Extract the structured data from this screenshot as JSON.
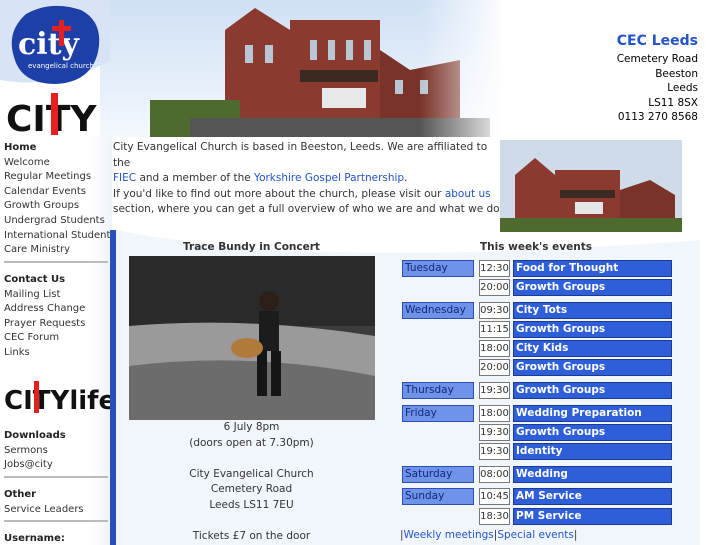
{
  "header": {
    "church_name": "CEC Leeds",
    "address": [
      "Cemetery Road",
      "Beeston",
      "Leeds",
      "LS11 8SX",
      "0113 270 8568"
    ],
    "logo_text": "city",
    "logo_subtext": "evangelical church",
    "logo_big": "CITY"
  },
  "nav": {
    "section1": [
      "Home",
      "Welcome",
      "Regular Meetings",
      "Calendar Events",
      "Growth Groups",
      "Undergrad Students",
      "International Students",
      "Care Ministry"
    ],
    "section2_head": "Contact Us",
    "section2": [
      "Mailing List",
      "Address Change",
      "Prayer Requests",
      "CEC Forum",
      "Links"
    ],
    "citylife_logo": "CITYlife",
    "section3_head": "Downloads",
    "section3": [
      "Sermons",
      "Jobs@city"
    ],
    "section4_head": "Other",
    "section4": [
      "Service Leaders"
    ],
    "username_label": "Username:"
  },
  "intro": {
    "p1_a": "City Evangelical Church is based in Beeston, Leeds. We are affiliated to the",
    "p1_link1": "FIEC",
    "p1_b": "and a member of the",
    "p1_link2": "Yorkshire Gospel Partnership",
    "p1_c": ".",
    "p2_a": "If you'd like to find out more about the church, please visit our",
    "p2_link": "about us",
    "p2_b": "section, where you can get a full overview of who we are and what we do."
  },
  "concert": {
    "title": "Trace Bundy in Concert",
    "lines": [
      "6 July 8pm",
      "(doors open at 7.30pm)",
      "",
      "City Evangelical Church",
      "Cemetery Road",
      "Leeds LS11 7EU",
      "",
      "Tickets £7 on the door"
    ]
  },
  "events": {
    "title": "This week's events",
    "rows": [
      {
        "day": "Tuesday",
        "time": "12:30",
        "name": "Food for Thought"
      },
      {
        "day": "",
        "time": "20:00",
        "name": "Growth Groups"
      },
      {
        "day": "Wednesday",
        "time": "09:30",
        "name": "City Tots"
      },
      {
        "day": "",
        "time": "11:15",
        "name": "Growth Groups"
      },
      {
        "day": "",
        "time": "18:00",
        "name": "City Kids"
      },
      {
        "day": "",
        "time": "20:00",
        "name": "Growth Groups"
      },
      {
        "day": "Thursday",
        "time": "19:30",
        "name": "Growth Groups"
      },
      {
        "day": "Friday",
        "time": "18:00",
        "name": "Wedding Preparation"
      },
      {
        "day": "",
        "time": "19:30",
        "name": "Growth Groups"
      },
      {
        "day": "",
        "time": "19:30",
        "name": "Identity"
      },
      {
        "day": "Saturday",
        "time": "08:00",
        "name": "Wedding"
      },
      {
        "day": "Sunday",
        "time": "10:45",
        "name": "AM Service"
      },
      {
        "day": "",
        "time": "18:30",
        "name": "PM Service"
      }
    ],
    "links_sep": "|",
    "link1": "Weekly meetings",
    "link2": "Special events"
  },
  "colors": {
    "accent": "#2354c8",
    "event_name_bg": "#2f5fd8",
    "day_bg": "#6f93e8"
  }
}
